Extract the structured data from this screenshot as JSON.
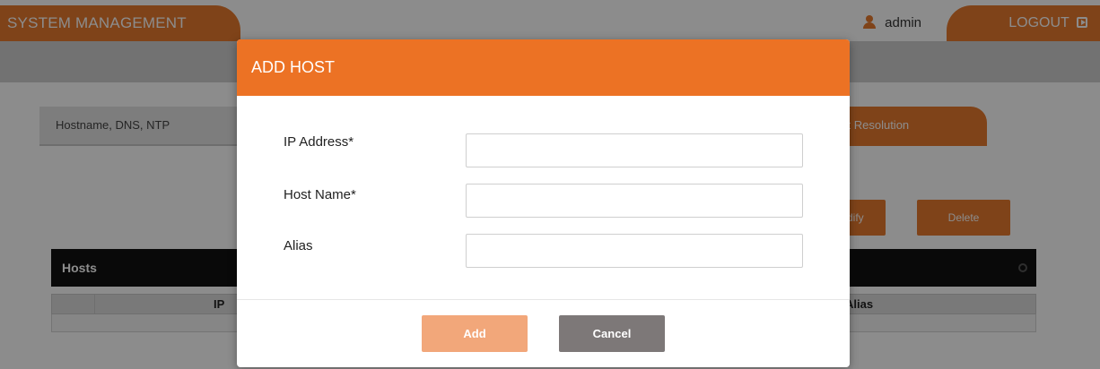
{
  "header": {
    "app_title": "SYSTEM MANAGEMENT",
    "username": "admin",
    "logout_label": "LOGOUT"
  },
  "tabs": {
    "hostname_dns_ntp": "Hostname, DNS, NTP",
    "host_resolution_visible": "st Resolution"
  },
  "toolbar": {
    "modify_visible": "dify",
    "delete_label": "Delete"
  },
  "hosts_table": {
    "title": "Hosts",
    "columns": [
      "IP",
      "Alias"
    ]
  },
  "modal": {
    "title": "ADD HOST",
    "fields": [
      {
        "label": "IP Address*",
        "value": ""
      },
      {
        "label": "Host Name*",
        "value": ""
      },
      {
        "label": "Alias",
        "value": ""
      }
    ],
    "add_label": "Add",
    "cancel_label": "Cancel"
  },
  "colors": {
    "accent": "#e87a2e",
    "modal_header": "#ec7224",
    "add_button": "#f2a77a",
    "cancel_button": "#7d7878",
    "subbar": "#d0d0d0"
  },
  "icons": [
    "user-icon",
    "logout-icon",
    "gear-icon"
  ]
}
